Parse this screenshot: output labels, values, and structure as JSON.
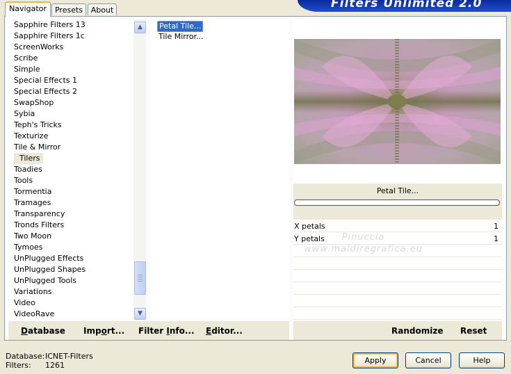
{
  "tabs": [
    "Navigator",
    "Presets",
    "About"
  ],
  "banner_title": "Filters Unlimited 2.0",
  "categories": [
    "Sapphire Filters 13",
    "Sapphire Filters 1c",
    "ScreenWorks",
    "Scribe",
    "Simple",
    "Special Effects 1",
    "Special Effects 2",
    "SwapShop",
    "Sybia",
    "Teph's Tricks",
    "Texturize",
    "Tile & Mirror",
    "Tilers",
    "Toadies",
    "Tools",
    "Tormentia",
    "Tramages",
    "Transparency",
    "Tronds Filters",
    "Two Moon",
    "Tymoes",
    "UnPlugged Effects",
    "UnPlugged Shapes",
    "UnPlugged Tools",
    "Variations",
    "Video",
    "VideoRave"
  ],
  "selected_category": "Tilers",
  "filters": [
    "Petal Tile...",
    "Tile Mirror..."
  ],
  "selected_filter": "Petal Tile...",
  "preview_filter_name": "Petal Tile...",
  "progress_fraction": 0,
  "params": [
    {
      "label": "X petals",
      "value": "1"
    },
    {
      "label": "Y petals",
      "value": "1"
    }
  ],
  "watermark": [
    "Pinuccia",
    "www.maldiregrafica.eu"
  ],
  "toolbar": {
    "database": "Database",
    "import": "Import...",
    "filter_info": "Filter Info...",
    "editor": "Editor...",
    "randomize": "Randomize",
    "reset": "Reset"
  },
  "status": {
    "database_label": "Database:",
    "database_value": "ICNET-Filters",
    "filters_label": "Filters:",
    "filters_value": "1261"
  },
  "buttons": {
    "apply": "Apply",
    "cancel": "Cancel",
    "help": "Help"
  },
  "colors": {
    "selection": "#316ac5",
    "tab_highlight": "#f8b33c",
    "banner": "#0a2a9c"
  }
}
